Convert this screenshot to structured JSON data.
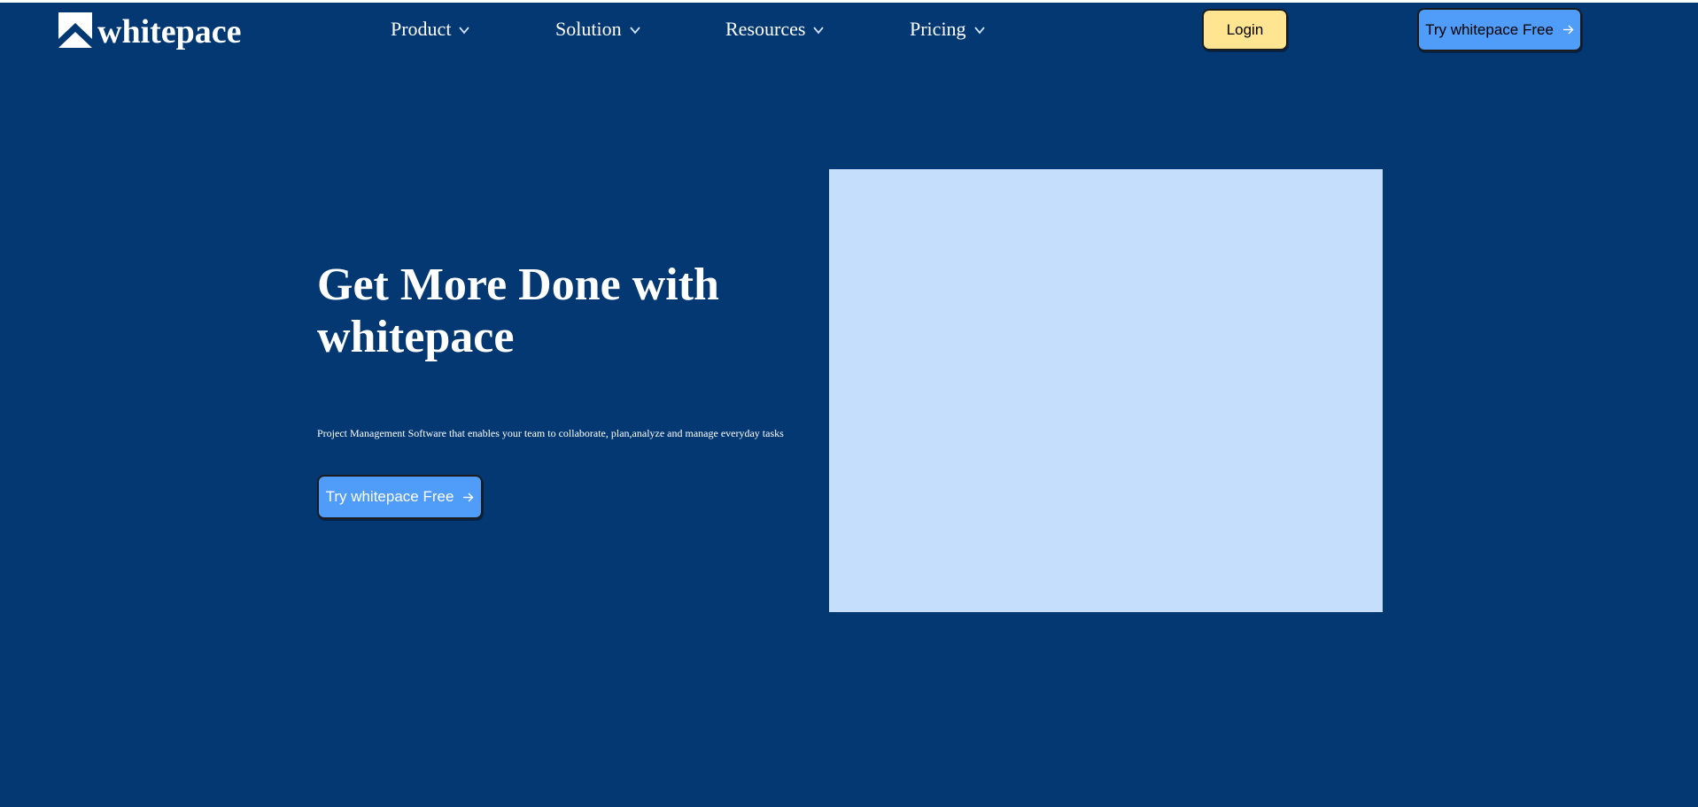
{
  "brand": {
    "name": "whitepace",
    "logo_icon": "chevron-up-logo-icon"
  },
  "nav": {
    "items": [
      {
        "label": "Product",
        "icon": "chevron-down-icon"
      },
      {
        "label": "Solution",
        "icon": "chevron-down-icon"
      },
      {
        "label": "Resources",
        "icon": "chevron-down-icon"
      },
      {
        "label": "Pricing",
        "icon": "chevron-down-icon"
      }
    ],
    "login_label": "Login",
    "try_label": "Try whitepace Free",
    "try_icon": "arrow-right-icon"
  },
  "hero": {
    "title": "Get More Done with whitepace",
    "subtitle": "Project Management Software that enables your team to collaborate, plan,analyze and manage everyday tasks",
    "cta_label": "Try whitepace Free",
    "cta_icon": "arrow-right-icon"
  },
  "colors": {
    "background": "#043873",
    "login_button": "#FFE492",
    "primary_button": "#4F9CF9",
    "image_placeholder": "#C4DEFC",
    "text": "#FFFFFF"
  }
}
